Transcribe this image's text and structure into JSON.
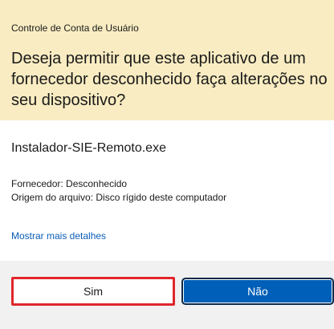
{
  "header": {
    "caption": "Controle de Conta de Usuário",
    "question": "Deseja permitir que este aplicativo de um fornecedor desconhecido faça alterações no seu dispositivo?"
  },
  "app": {
    "file_name": "Instalador-SIE-Remoto.exe"
  },
  "details": {
    "publisher": "Fornecedor: Desconhecido",
    "origin": "Origem do arquivo: Disco rígido deste computador"
  },
  "links": {
    "more_details": "Mostrar mais detalhes"
  },
  "buttons": {
    "yes_label": "Sim",
    "no_label": "Não"
  },
  "colors": {
    "header_background": "#f9ecc2",
    "link": "#0a5db8",
    "primary_button": "#005fb8",
    "highlight_outline": "#e0262b",
    "footer_background": "#f1f1f1"
  }
}
